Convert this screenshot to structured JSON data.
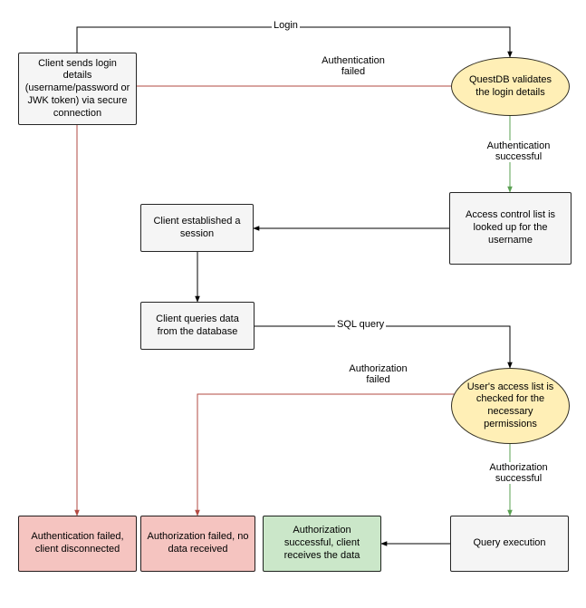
{
  "nodes": {
    "client_login": "Client sends login details (username/password or JWK token) via secure connection",
    "validate": "QuestDB validates the login details",
    "acl_lookup": "Access control list is looked up for the username",
    "session": "Client established a session",
    "query": "Client queries data from the database",
    "check_perms": "User's access list is checked for the necessary permissions",
    "auth_failed": "Authentication failed, client disconnected",
    "authz_failed": "Authorization failed, no data received",
    "authz_ok": "Authorization successful, client receives the data",
    "exec": "Query execution"
  },
  "edges": {
    "login": "Login",
    "authn_failed": "Authentication failed",
    "authn_ok": "Authentication successful",
    "sql_query": "SQL query",
    "authz_failed": "Authorization failed",
    "authz_ok": "Authorization successful"
  }
}
